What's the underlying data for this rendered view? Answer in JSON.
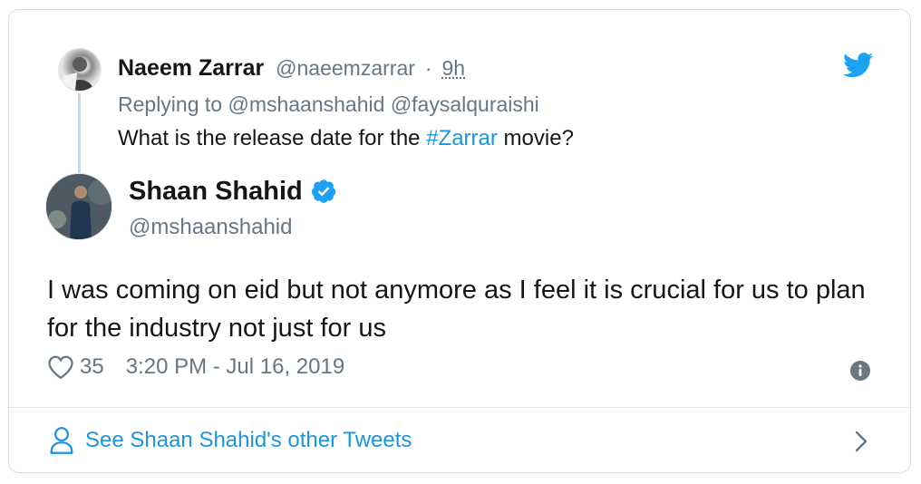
{
  "parent_tweet": {
    "name": "Naeem Zarrar",
    "handle": "@naeemzarrar",
    "separator": "·",
    "time_ago": "9h",
    "replying_prefix": "Replying to",
    "replying_to": [
      "@mshaanshahid",
      "@faysalquraishi"
    ],
    "text_before": "What is the release date for the ",
    "hashtag": "#Zarrar",
    "text_after": " movie?"
  },
  "main_tweet": {
    "name": "Shaan Shahid",
    "handle": "@mshaanshahid",
    "text": "I was coming on eid but not anymore as I feel it is crucial for us to plan for the industry not just for us",
    "like_count": "35",
    "timestamp": "3:20 PM - Jul 16, 2019"
  },
  "footer": {
    "label": "See Shaan Shahid's other Tweets"
  },
  "icons": {
    "brand": "twitter-icon",
    "verified": "verified-badge-icon",
    "like": "heart-icon",
    "info": "info-icon",
    "profile": "person-icon",
    "next": "chevron-right-icon"
  },
  "colors": {
    "link": "#1b95e0",
    "secondary_text": "#657786",
    "primary_text": "#14171a",
    "border": "#e1e8ed"
  }
}
